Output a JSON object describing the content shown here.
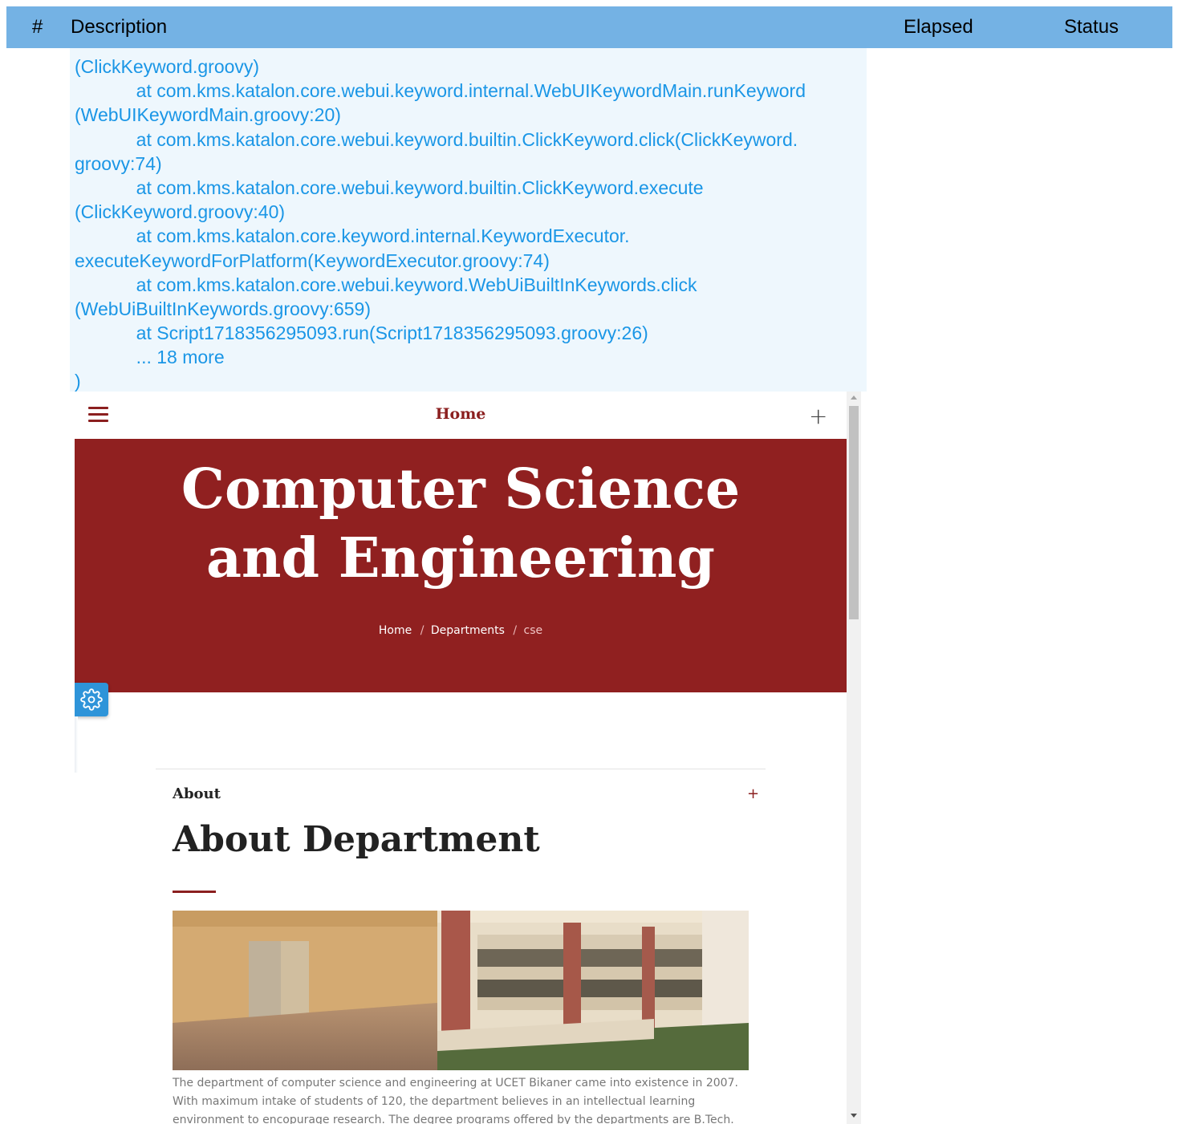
{
  "table_header": {
    "num": "#",
    "description": "Description",
    "elapsed": "Elapsed",
    "status": "Status"
  },
  "log_lines": [
    "(ClickKeyword.groovy)",
    "            at com.kms.katalon.core.webui.keyword.internal.WebUIKeywordMain.runKeyword",
    "(WebUIKeywordMain.groovy:20)",
    "            at com.kms.katalon.core.webui.keyword.builtin.ClickKeyword.click(ClickKeyword.",
    "groovy:74)",
    "            at com.kms.katalon.core.webui.keyword.builtin.ClickKeyword.execute",
    "(ClickKeyword.groovy:40)",
    "            at com.kms.katalon.core.keyword.internal.KeywordExecutor.",
    "executeKeywordForPlatform(KeywordExecutor.groovy:74)",
    "            at com.kms.katalon.core.webui.keyword.WebUiBuiltInKeywords.click",
    "(WebUiBuiltInKeywords.groovy:659)",
    "            at Script1718356295093.run(Script1718356295093.groovy:26)",
    "            ... 18 more",
    ")"
  ],
  "site": {
    "nav_title": "Home",
    "hero_title_line1": "Computer Science",
    "hero_title_line2": "and Engineering",
    "breadcrumb": {
      "home": "Home",
      "departments": "Departments",
      "current": "cse",
      "separator": "/"
    },
    "about": {
      "tab": "About",
      "plus": "+",
      "heading": "About Department",
      "text_line1": "The department of computer science and engineering at UCET Bikaner came into existence in 2007.",
      "text_line2": "With maximum intake of students of 120, the department believes in an intellectual learning",
      "text_line3": "environment to encopurage research. The degree programs offered by the departments are B.Tech. in"
    },
    "colors": {
      "brand": "#902020",
      "header_blue": "#74b2e4",
      "log_text": "#1a96e6"
    }
  }
}
